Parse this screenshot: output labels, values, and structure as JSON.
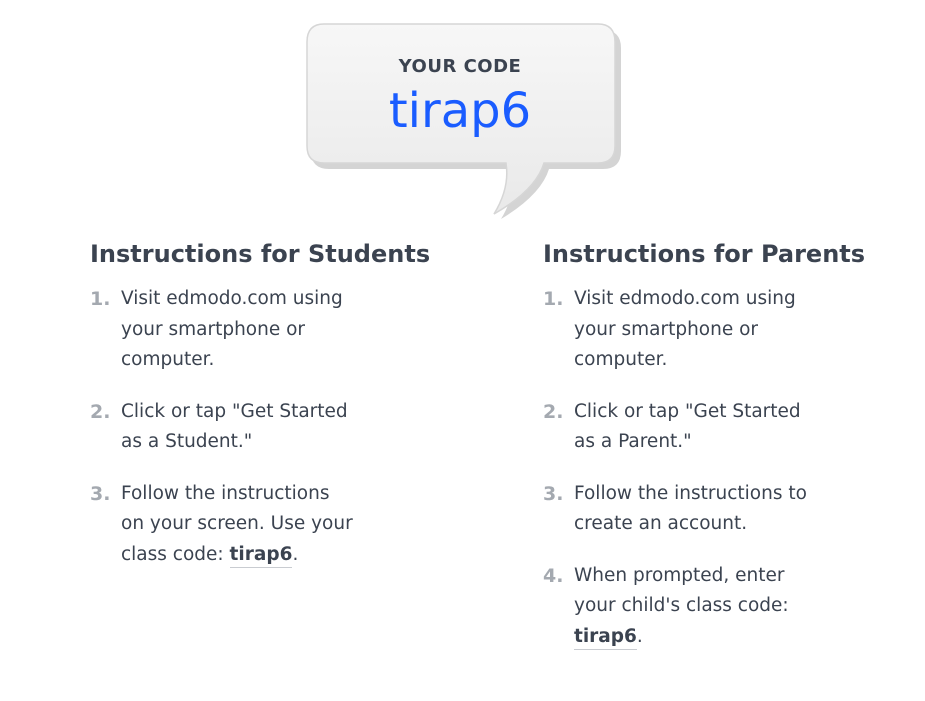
{
  "bubble": {
    "label": "YOUR CODE",
    "code": "tirap6"
  },
  "students": {
    "heading": "Instructions for Students",
    "steps": [
      {
        "num": "1.",
        "line1": "Visit edmodo.com using",
        "line2": "your smartphone or",
        "line3": "computer."
      },
      {
        "num": "2.",
        "line1": "Click or tap \"Get Started",
        "line2": "as a Student.\""
      },
      {
        "num": "3.",
        "line1": "Follow the instructions",
        "line2": "on your screen. Use your",
        "line3": "class code: ",
        "code": "tirap6",
        "suffix": "."
      }
    ]
  },
  "parents": {
    "heading": "Instructions for Parents",
    "steps": [
      {
        "num": "1.",
        "line1": "Visit edmodo.com using",
        "line2": "your smartphone or",
        "line3": "computer."
      },
      {
        "num": "2.",
        "line1": "Click or tap \"Get Started",
        "line2": "as a Parent.\""
      },
      {
        "num": "3.",
        "line1": "Follow the instructions to",
        "line2": "create an account."
      },
      {
        "num": "4.",
        "line1": "When prompted, enter",
        "line2": "your child's class code:",
        "code": "tirap6",
        "suffix": "."
      }
    ]
  },
  "colors": {
    "code_blue": "#1a5cff",
    "text": "#3b4350",
    "number_gray": "#a4a9b0"
  }
}
